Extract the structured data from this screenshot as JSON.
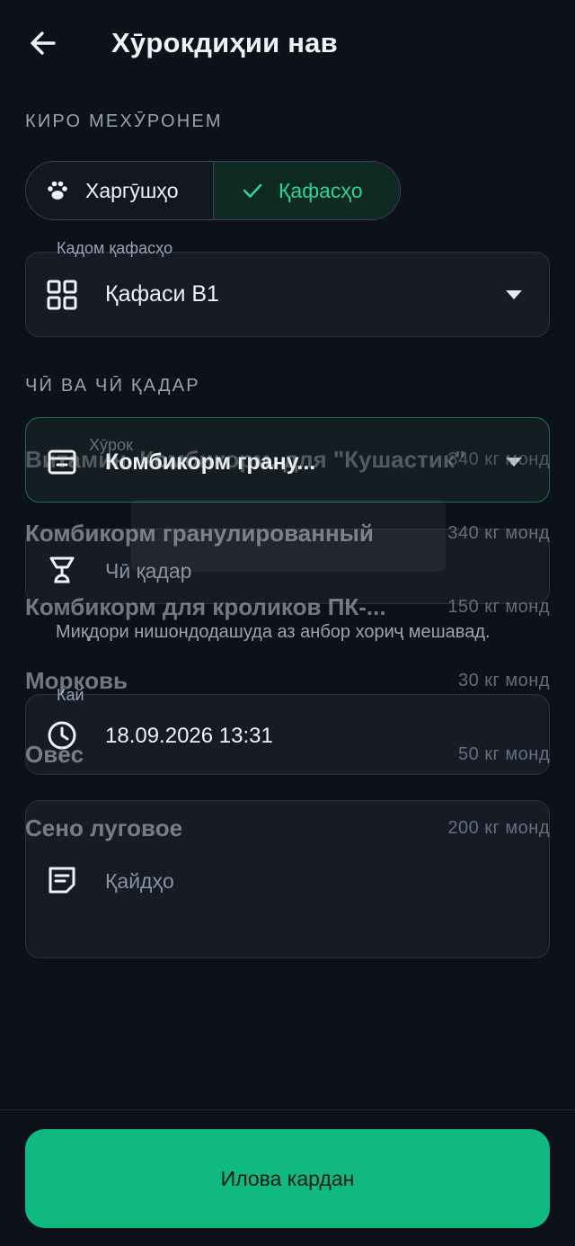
{
  "header": {
    "title": "Хӯрокдиҳии нав"
  },
  "section_animals": "КИРО МЕХӮРОНЕМ",
  "segmented": {
    "option_rabbits": "Харгӯшҳо",
    "option_cages": "Қафасҳо",
    "selected": "option_cages"
  },
  "cage_field": {
    "label": "Кадом қафасҳо",
    "value": "Қафаси B1"
  },
  "section_what": "ЧӢ ВА ЧӢ ҚАДАР",
  "feed_field": {
    "label": "Хӯрок",
    "value": "Комбикорм грану...",
    "extra_name_behind": "Витамин. Комбикорм. для \"Кушастик\"",
    "extra_qty_behind": "340 кг монд"
  },
  "quantity_field": {
    "placeholder": "Чӣ қадар"
  },
  "hint": "Миқдори нишондодашуда аз анбор хориҷ мешавад.",
  "time_field": {
    "label": "Кай",
    "value": "18.09.2026 13:31"
  },
  "notes_field": {
    "placeholder": "Қайдҳо"
  },
  "dropdown_items": [
    {
      "name": "Комбикорм гранулированный",
      "qty": "340 кг монд"
    },
    {
      "name": "Комбикорм для кроликов ПК-...",
      "qty": "150 кг монд"
    },
    {
      "name": "Морковь",
      "qty": "30 кг монд"
    },
    {
      "name": "Овёс",
      "qty": "50 кг монд"
    },
    {
      "name": "Сено луговое",
      "qty": "200 кг монд"
    }
  ],
  "submit_label": "Илова кардан",
  "colors": {
    "background": "#0d111a",
    "accent": "#10b981",
    "accent_text": "#2ed39a",
    "field_bg": "#161b26"
  }
}
